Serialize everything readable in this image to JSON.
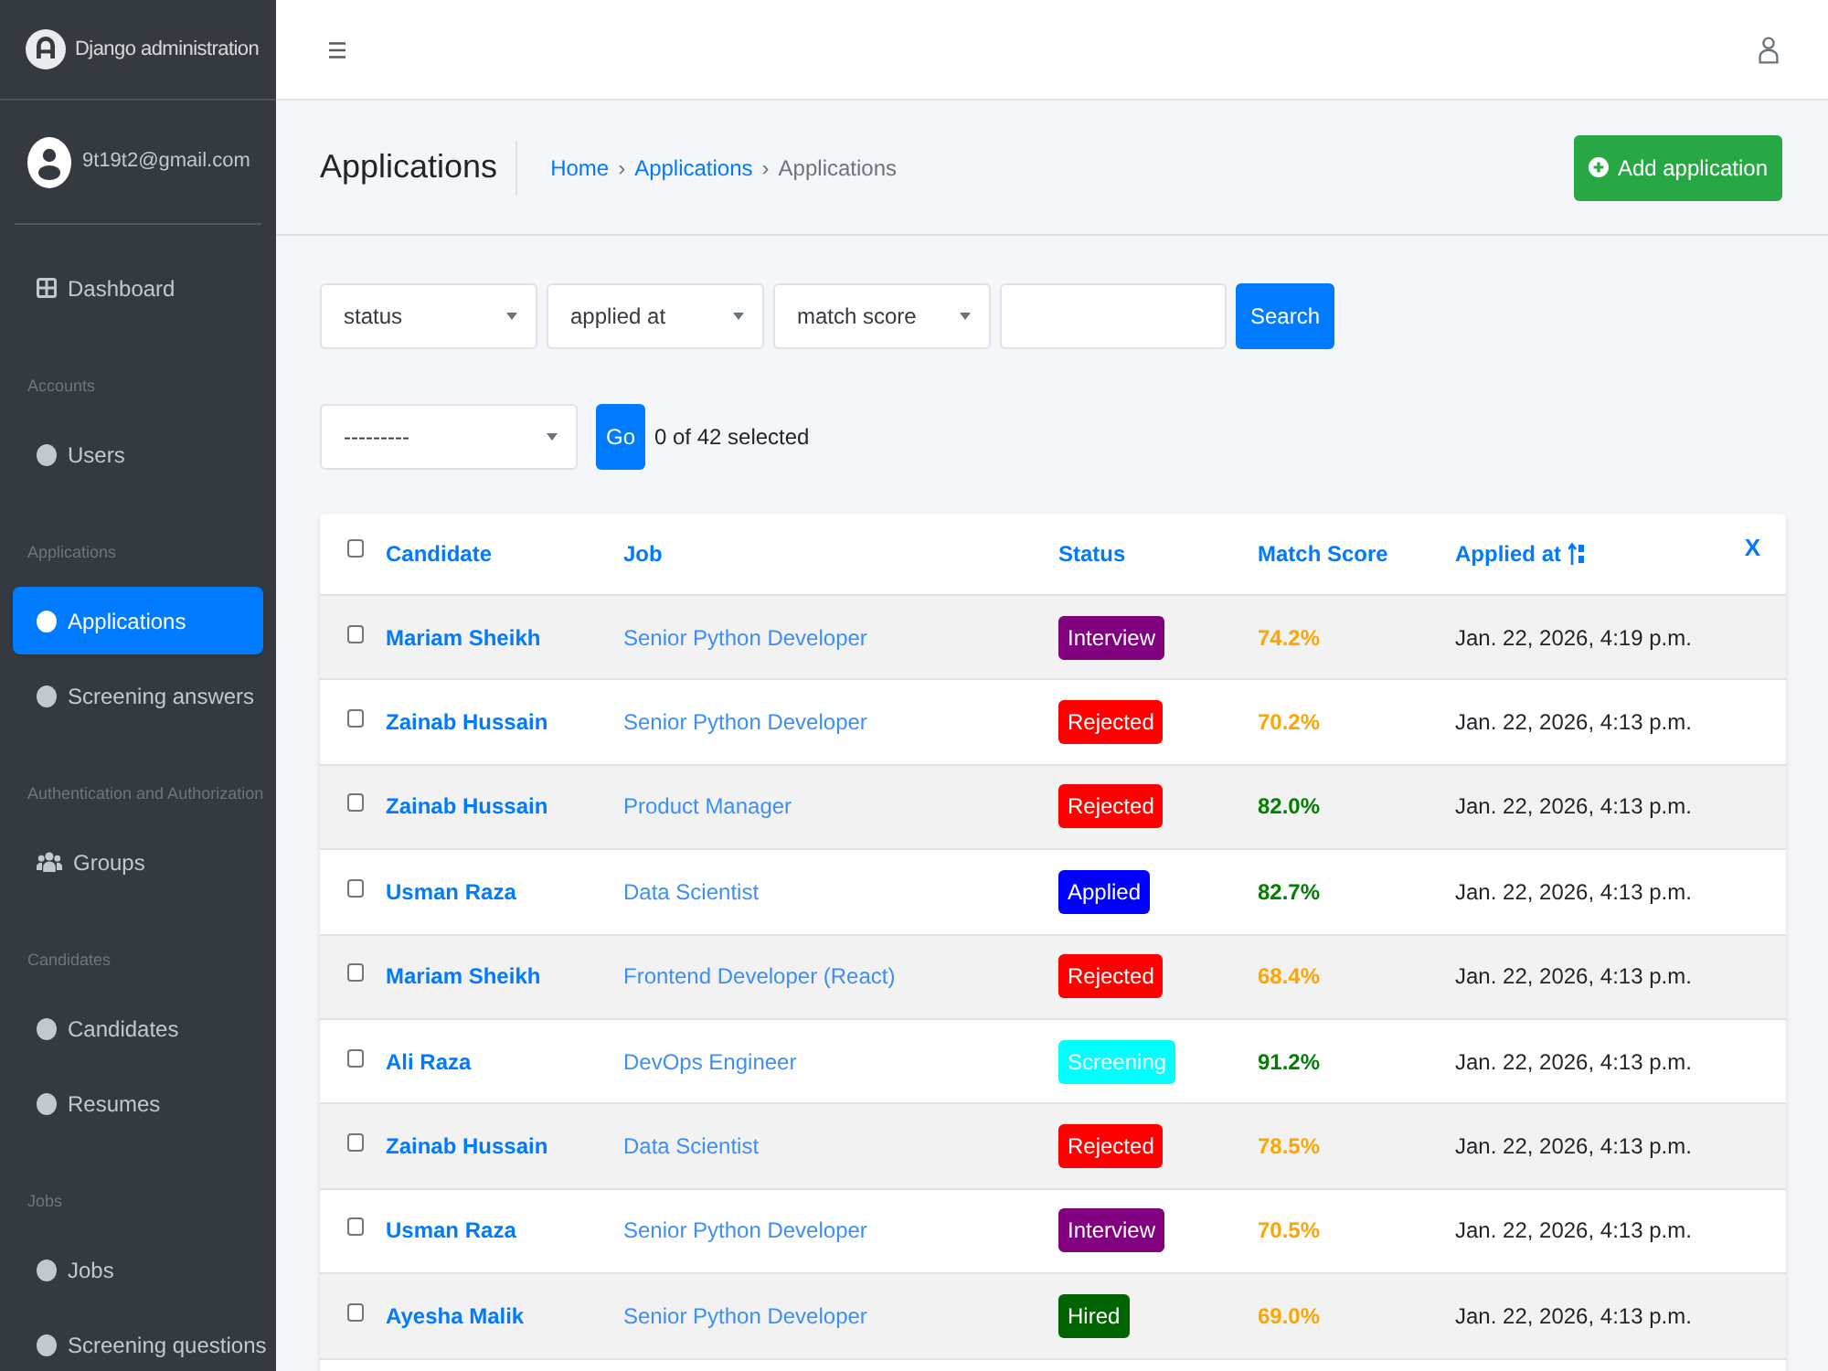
{
  "brand": {
    "title": "Django administration"
  },
  "user": {
    "email": "9t19t2@gmail.com"
  },
  "sidebar": {
    "sections": [
      {
        "items": [
          {
            "label": "Dashboard",
            "kind": "dashboard",
            "selected": false
          }
        ]
      },
      {
        "header": "Accounts",
        "items": [
          {
            "label": "Users",
            "kind": "model",
            "selected": false
          }
        ]
      },
      {
        "header": "Applications",
        "items": [
          {
            "label": "Applications",
            "kind": "model",
            "selected": true
          },
          {
            "label": "Screening answers",
            "kind": "model",
            "selected": false
          }
        ]
      },
      {
        "header": "Authentication and Authorization",
        "items": [
          {
            "label": "Groups",
            "kind": "groups",
            "selected": false
          }
        ]
      },
      {
        "header": "Candidates",
        "items": [
          {
            "label": "Candidates",
            "kind": "model",
            "selected": false
          },
          {
            "label": "Resumes",
            "kind": "model",
            "selected": false
          }
        ]
      },
      {
        "header": "Jobs",
        "items": [
          {
            "label": "Jobs",
            "kind": "model",
            "selected": false
          },
          {
            "label": "Screening questions",
            "kind": "model",
            "selected": false
          }
        ]
      }
    ]
  },
  "page": {
    "title": "Applications",
    "breadcrumbs": [
      {
        "label": "Home",
        "kind": "link"
      },
      {
        "label": "›",
        "kind": "separator"
      },
      {
        "label": "Applications",
        "kind": "link"
      },
      {
        "label": "›",
        "kind": "separator"
      },
      {
        "label": "Applications",
        "kind": "current"
      }
    ],
    "add_button": "Add application"
  },
  "filters": {
    "selects": [
      {
        "value": "status"
      },
      {
        "value": "applied at"
      },
      {
        "value": "match score"
      }
    ],
    "search_button": "Search"
  },
  "actions": {
    "select": "---------",
    "button": "Go",
    "counter": "0 of 42 selected"
  },
  "table": {
    "header_checked": false,
    "columns": [
      {
        "label": "Candidate",
        "sorted": false
      },
      {
        "label": "Job",
        "sorted": false
      },
      {
        "label": "Status",
        "sorted": false
      },
      {
        "label": "Match Score",
        "sorted": false
      },
      {
        "label": "Applied at",
        "sorted": true
      }
    ],
    "clear_sort": "X",
    "rows": [
      {
        "checked": false,
        "candidate": "Mariam Sheikh",
        "job": "Senior Python Developer",
        "status": {
          "label": "Interview",
          "color": "#800080"
        },
        "match_score": {
          "text": "74.2%",
          "color": "#ffa500"
        },
        "applied_at": "Jan. 22, 2026, 4:19 p.m."
      },
      {
        "checked": false,
        "candidate": "Zainab Hussain",
        "job": "Senior Python Developer",
        "status": {
          "label": "Rejected",
          "color": "#ff0000"
        },
        "match_score": {
          "text": "70.2%",
          "color": "#ffa500"
        },
        "applied_at": "Jan. 22, 2026, 4:13 p.m."
      },
      {
        "checked": false,
        "candidate": "Zainab Hussain",
        "job": "Product Manager",
        "status": {
          "label": "Rejected",
          "color": "#ff0000"
        },
        "match_score": {
          "text": "82.0%",
          "color": "#008000"
        },
        "applied_at": "Jan. 22, 2026, 4:13 p.m."
      },
      {
        "checked": false,
        "candidate": "Usman Raza",
        "job": "Data Scientist",
        "status": {
          "label": "Applied",
          "color": "#0000ff"
        },
        "match_score": {
          "text": "82.7%",
          "color": "#008000"
        },
        "applied_at": "Jan. 22, 2026, 4:13 p.m."
      },
      {
        "checked": false,
        "candidate": "Mariam Sheikh",
        "job": "Frontend Developer (React)",
        "status": {
          "label": "Rejected",
          "color": "#ff0000"
        },
        "match_score": {
          "text": "68.4%",
          "color": "#ffa500"
        },
        "applied_at": "Jan. 22, 2026, 4:13 p.m."
      },
      {
        "checked": false,
        "candidate": "Ali Raza",
        "job": "DevOps Engineer",
        "status": {
          "label": "Screening",
          "color": "#00ffff"
        },
        "match_score": {
          "text": "91.2%",
          "color": "#008000"
        },
        "applied_at": "Jan. 22, 2026, 4:13 p.m."
      },
      {
        "checked": false,
        "candidate": "Zainab Hussain",
        "job": "Data Scientist",
        "status": {
          "label": "Rejected",
          "color": "#ff0000"
        },
        "match_score": {
          "text": "78.5%",
          "color": "#ffa500"
        },
        "applied_at": "Jan. 22, 2026, 4:13 p.m."
      },
      {
        "checked": false,
        "candidate": "Usman Raza",
        "job": "Senior Python Developer",
        "status": {
          "label": "Interview",
          "color": "#800080"
        },
        "match_score": {
          "text": "70.5%",
          "color": "#ffa500"
        },
        "applied_at": "Jan. 22, 2026, 4:13 p.m."
      },
      {
        "checked": false,
        "candidate": "Ayesha Malik",
        "job": "Senior Python Developer",
        "status": {
          "label": "Hired",
          "color": "#006400"
        },
        "match_score": {
          "text": "69.0%",
          "color": "#ffa500"
        },
        "applied_at": "Jan. 22, 2026, 4:13 p.m."
      }
    ]
  }
}
